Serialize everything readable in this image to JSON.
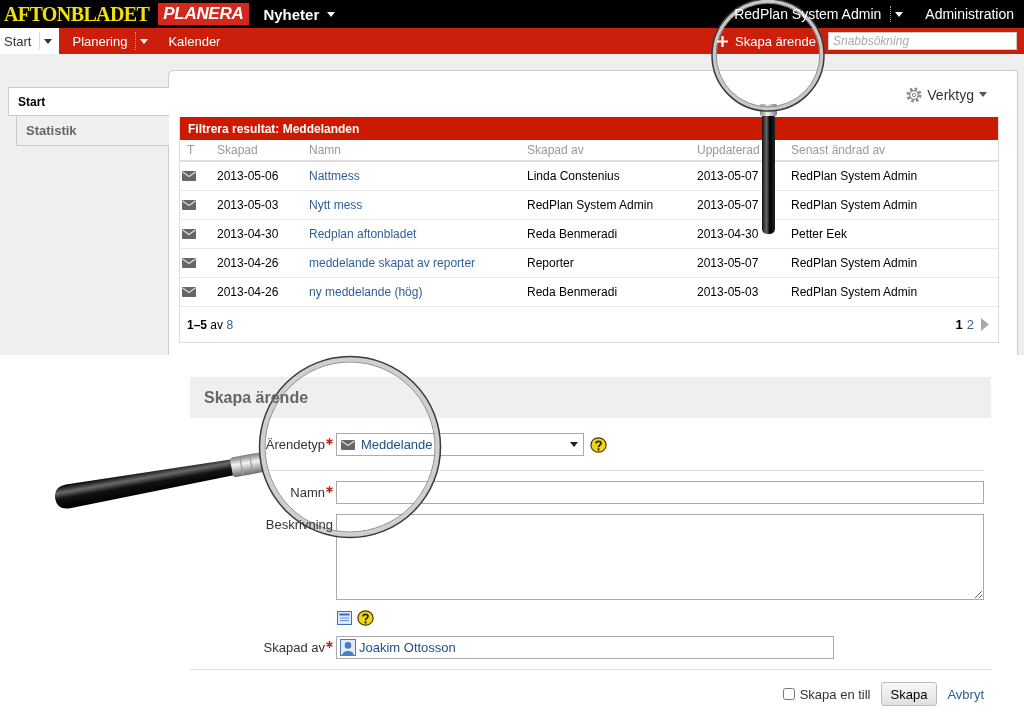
{
  "header": {
    "logo": "AFTONBLADET",
    "product": "PLANERA",
    "section": "Nyheter",
    "user": "RedPlan System Admin",
    "admin_link": "Administration"
  },
  "nav": {
    "tabs": [
      {
        "label": "Start",
        "selected": true,
        "dropdown": true
      },
      {
        "label": "Planering",
        "selected": false,
        "dropdown": true
      },
      {
        "label": "Kalender",
        "selected": false,
        "dropdown": false
      }
    ],
    "create_button": "Skapa ärende",
    "search": {
      "placeholder": "Snabbsökning"
    }
  },
  "sidebar": {
    "items": [
      {
        "label": "Start",
        "selected": true
      },
      {
        "label": "Statistik",
        "selected": false
      }
    ]
  },
  "panel": {
    "tools_button": "Verktyg",
    "filter_title": "Filtrera resultat: Meddelanden",
    "table": {
      "columns": [
        "T",
        "Skapad",
        "Namn",
        "Skapad av",
        "Uppdaterad",
        "Senast ändrad av"
      ],
      "rows": [
        {
          "created": "2013-05-06",
          "name": "Nattmess",
          "created_by": "Linda Constenius",
          "updated": "2013-05-07",
          "modified_by": "RedPlan System Admin"
        },
        {
          "created": "2013-05-03",
          "name": "Nytt mess",
          "created_by": "RedPlan System Admin",
          "updated": "2013-05-07",
          "modified_by": "RedPlan System Admin"
        },
        {
          "created": "2013-04-30",
          "name": "Redplan aftonbladet",
          "created_by": "Reda Benmeradi",
          "updated": "2013-04-30",
          "modified_by": "Petter Eek"
        },
        {
          "created": "2013-04-26",
          "name": "meddelande skapat av reporter",
          "created_by": "Reporter",
          "updated": "2013-05-07",
          "modified_by": "RedPlan System Admin"
        },
        {
          "created": "2013-04-26",
          "name": "ny meddelande (hög)",
          "created_by": "Reda Benmeradi",
          "updated": "2013-05-03",
          "modified_by": "RedPlan System Admin"
        }
      ]
    },
    "pager": {
      "summary": "**1–5** av",
      "total": "8",
      "pages": [
        {
          "label": "1",
          "selected": true
        },
        {
          "label": "2",
          "selected": false
        }
      ]
    }
  },
  "form": {
    "title": "Skapa ärende",
    "fields": [
      {
        "kind": "select",
        "label": "Ärendetyp",
        "required": true,
        "value": "Meddelande"
      },
      {
        "kind": "text",
        "label": "Namn",
        "required": true
      },
      {
        "kind": "textarea",
        "label": "Beskrivning",
        "required": false
      },
      {
        "kind": "person",
        "label": "Skapad av",
        "required": true,
        "value": "Joakim Ottosson"
      }
    ],
    "create_another": {
      "label": "Skapa en till",
      "checked": false
    },
    "submit_button": "Skapa",
    "cancel_link": "Avbryt"
  }
}
